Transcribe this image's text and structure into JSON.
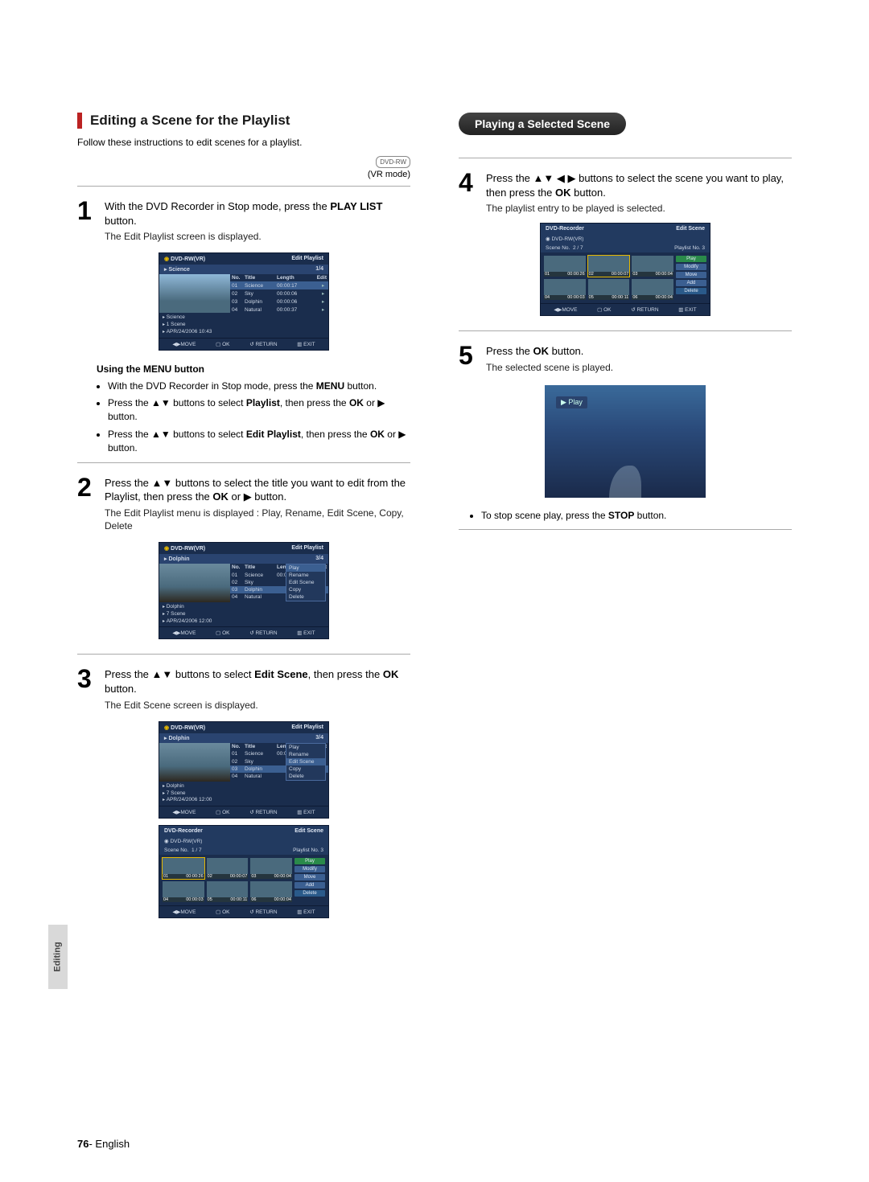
{
  "left": {
    "title": "Editing a Scene for the Playlist",
    "intro": "Follow these instructions to edit scenes for a playlist.",
    "vr_badge": "DVD-RW",
    "vr_mode": "(VR mode)",
    "step1": {
      "num": "1",
      "text_a": "With the DVD Recorder in Stop mode, press the ",
      "text_b": "PLAY LIST",
      "text_c": " button.",
      "sub": "The Edit Playlist screen is displayed."
    },
    "menu_head": "Using the MENU button",
    "menu1_a": "With the DVD Recorder in Stop mode, press the ",
    "menu1_b": "MENU",
    "menu1_c": " button.",
    "menu2_a": "Press the ▲▼ buttons to select ",
    "menu2_b": "Playlist",
    "menu2_c": ", then press the ",
    "menu2_d": "OK",
    "menu2_e": " or ▶ button.",
    "menu3_a": "Press the ▲▼ buttons to select ",
    "menu3_b": "Edit Playlist",
    "menu3_c": ", then press the ",
    "menu3_d": "OK",
    "menu3_e": " or ▶ button.",
    "step2": {
      "num": "2",
      "text_a": "Press the ▲▼ buttons to select the title you want to edit from the Playlist, then press the ",
      "text_b": "OK",
      "text_c": " or ▶ button.",
      "sub": "The Edit Playlist menu is displayed : Play, Rename, Edit Scene, Copy, Delete"
    },
    "step3": {
      "num": "3",
      "text_a": "Press the ▲▼ buttons to select ",
      "text_b": "Edit Scene",
      "text_c": ", then press the ",
      "text_d": "OK",
      "text_e": " button.",
      "sub": "The Edit Scene screen is displayed."
    }
  },
  "right": {
    "pill": "Playing a Selected Scene",
    "step4": {
      "num": "4",
      "text_a": "Press the ▲▼ ◀ ▶ buttons to select the scene you want to play, then press the ",
      "text_b": "OK",
      "text_c": " button.",
      "sub": "The playlist entry to be played is selected."
    },
    "step5": {
      "num": "5",
      "text_a": "Press the ",
      "text_b": "OK",
      "text_c": " button.",
      "sub": "The selected scene is played."
    },
    "play_tag": "▶ Play",
    "stop_a": "To stop scene play, press the ",
    "stop_b": "STOP",
    "stop_c": " button."
  },
  "osd": {
    "disc": "DVD-RW(VR)",
    "edit_playlist": "Edit Playlist",
    "edit_scene": "Edit Scene",
    "recorder": "DVD-Recorder",
    "sci_name": "Science",
    "dol_name": "Dolphin",
    "sci_count": "1/4",
    "dol_count": "3/4",
    "cols": {
      "no": "No.",
      "title": "Title",
      "length": "Length",
      "edit": "Edit"
    },
    "rows": [
      {
        "n": "01",
        "t": "Science",
        "l": "00:00:17"
      },
      {
        "n": "02",
        "t": "Sky",
        "l": "00:00:06"
      },
      {
        "n": "03",
        "t": "Dolphin",
        "l": "00:00:06"
      },
      {
        "n": "04",
        "t": "Natural",
        "l": "00:00:37"
      }
    ],
    "info_sci": {
      "a": "Science",
      "b": "1 Scene",
      "c": "APR/24/2006 10:43"
    },
    "info_dol": {
      "a": "Dolphin",
      "b": "7 Scene",
      "c": "APR/24/2006 12:00"
    },
    "foot": {
      "move": "◀▶MOVE",
      "ok": "▢ OK",
      "ret": "↺ RETURN",
      "exit": "▥ EXIT"
    },
    "menu": {
      "play": "Play",
      "rename": "Rename",
      "editscene": "Edit Scene",
      "copy": "Copy",
      "delete": "Delete"
    },
    "scene": {
      "sceneno": "Scene No.",
      "idx1": "1 / 7",
      "idx2": "2 / 7",
      "plno": "Playlist No. 3",
      "cells": [
        {
          "n": "01",
          "t": "00:00:26"
        },
        {
          "n": "02",
          "t": "00:00:07"
        },
        {
          "n": "03",
          "t": "00:00:04"
        },
        {
          "n": "04",
          "t": "00:00:03"
        },
        {
          "n": "05",
          "t": "00:00:11"
        },
        {
          "n": "06",
          "t": "00:00:04"
        }
      ],
      "btns": {
        "play": "Play",
        "modify": "Modify",
        "move": "Move",
        "add": "Add",
        "delete": "Delete"
      }
    }
  },
  "sidetab": "Editing",
  "footer": {
    "page": "76",
    "sep": "- ",
    "lang": "English"
  }
}
